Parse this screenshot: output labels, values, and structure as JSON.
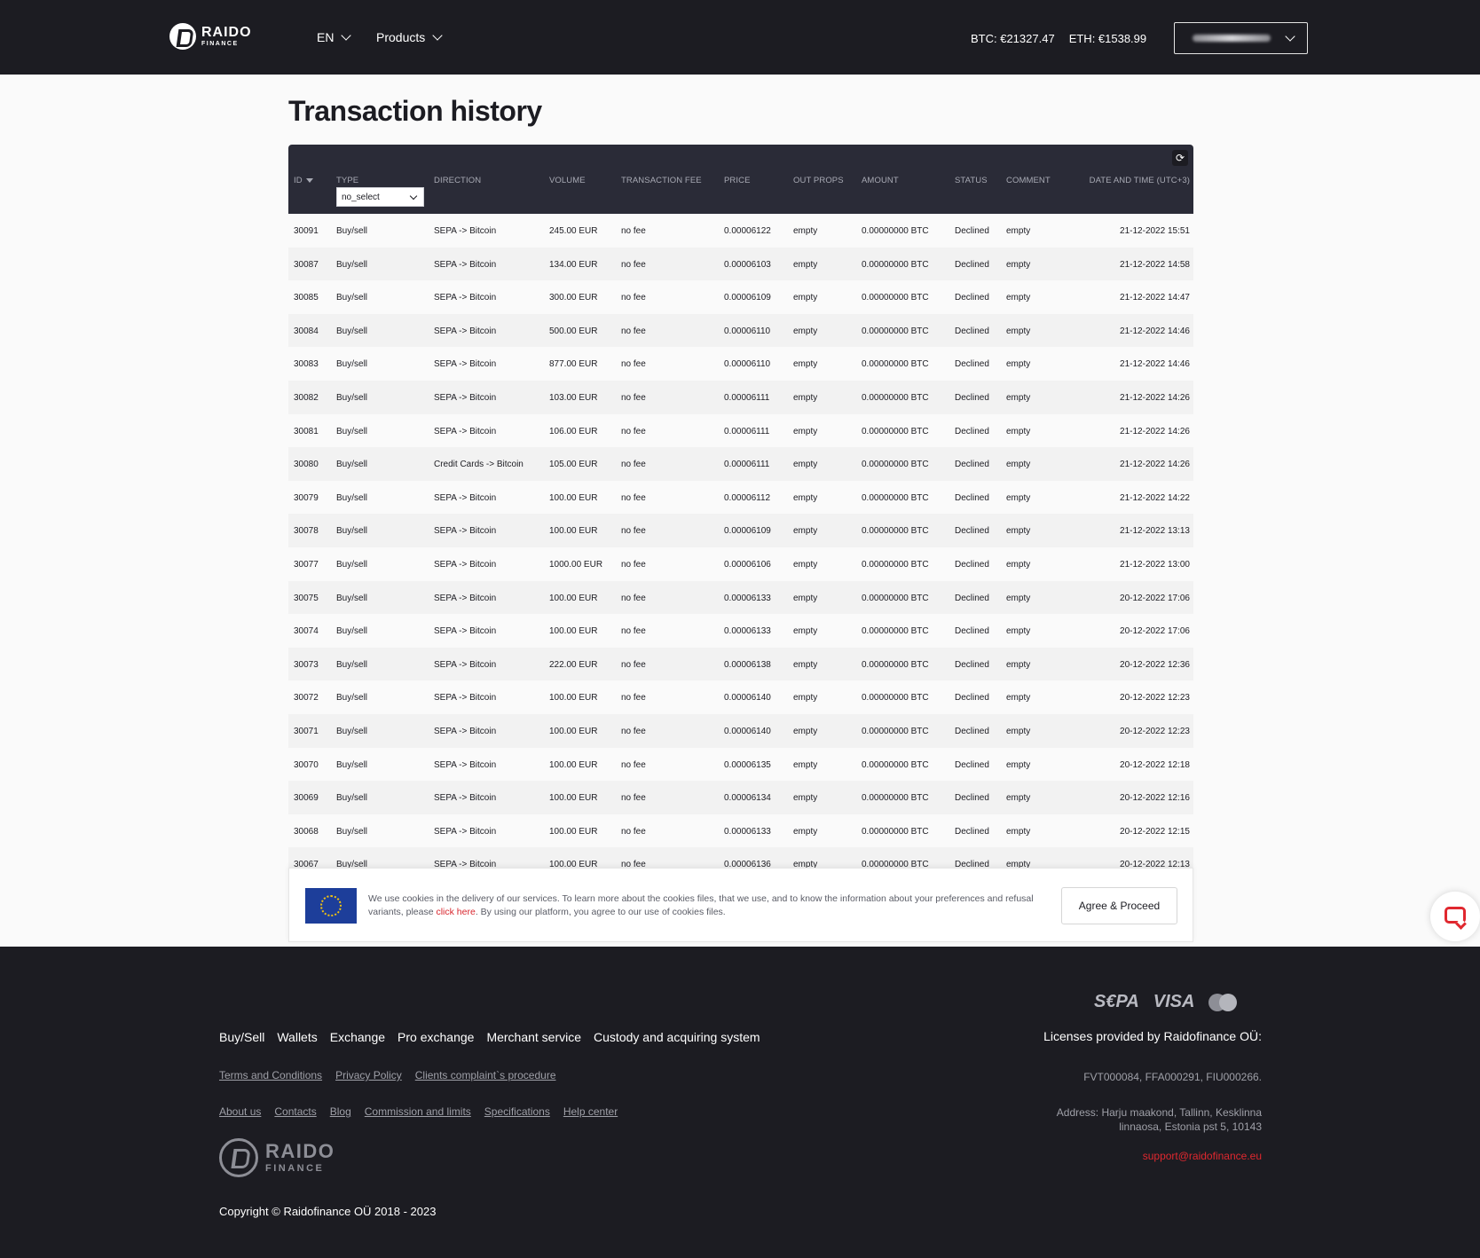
{
  "header": {
    "logo": {
      "name": "RAIDO",
      "sub": "FINANCE"
    },
    "language": "EN",
    "products": "Products",
    "btc_rate": "BTC: €21327.47",
    "eth_rate": "ETH: €1538.99"
  },
  "page": {
    "title": "Transaction history"
  },
  "table": {
    "columns": {
      "id": "ID",
      "type": "TYPE",
      "direction": "DIRECTION",
      "volume": "VOLUME",
      "fee": "TRANSACTION FEE",
      "price": "PRICE",
      "out_props": "OUT PROPS",
      "amount": "AMOUNT",
      "status": "STATUS",
      "comment": "COMMENT",
      "date": "DATE AND TIME (UTC+3)"
    },
    "type_filter": "no_select",
    "rows": [
      {
        "id": "30091",
        "type": "Buy/sell",
        "direction": "SEPA -> Bitcoin",
        "volume": "245.00 EUR",
        "fee": "no fee",
        "price": "0.00006122",
        "out_props": "empty",
        "amount": "0.00000000 BTC",
        "status": "Declined",
        "comment": "empty",
        "date": "21-12-2022 15:51"
      },
      {
        "id": "30087",
        "type": "Buy/sell",
        "direction": "SEPA -> Bitcoin",
        "volume": "134.00 EUR",
        "fee": "no fee",
        "price": "0.00006103",
        "out_props": "empty",
        "amount": "0.00000000 BTC",
        "status": "Declined",
        "comment": "empty",
        "date": "21-12-2022 14:58"
      },
      {
        "id": "30085",
        "type": "Buy/sell",
        "direction": "SEPA -> Bitcoin",
        "volume": "300.00 EUR",
        "fee": "no fee",
        "price": "0.00006109",
        "out_props": "empty",
        "amount": "0.00000000 BTC",
        "status": "Declined",
        "comment": "empty",
        "date": "21-12-2022 14:47"
      },
      {
        "id": "30084",
        "type": "Buy/sell",
        "direction": "SEPA -> Bitcoin",
        "volume": "500.00 EUR",
        "fee": "no fee",
        "price": "0.00006110",
        "out_props": "empty",
        "amount": "0.00000000 BTC",
        "status": "Declined",
        "comment": "empty",
        "date": "21-12-2022 14:46"
      },
      {
        "id": "30083",
        "type": "Buy/sell",
        "direction": "SEPA -> Bitcoin",
        "volume": "877.00 EUR",
        "fee": "no fee",
        "price": "0.00006110",
        "out_props": "empty",
        "amount": "0.00000000 BTC",
        "status": "Declined",
        "comment": "empty",
        "date": "21-12-2022 14:46"
      },
      {
        "id": "30082",
        "type": "Buy/sell",
        "direction": "SEPA -> Bitcoin",
        "volume": "103.00 EUR",
        "fee": "no fee",
        "price": "0.00006111",
        "out_props": "empty",
        "amount": "0.00000000 BTC",
        "status": "Declined",
        "comment": "empty",
        "date": "21-12-2022 14:26"
      },
      {
        "id": "30081",
        "type": "Buy/sell",
        "direction": "SEPA -> Bitcoin",
        "volume": "106.00 EUR",
        "fee": "no fee",
        "price": "0.00006111",
        "out_props": "empty",
        "amount": "0.00000000 BTC",
        "status": "Declined",
        "comment": "empty",
        "date": "21-12-2022 14:26"
      },
      {
        "id": "30080",
        "type": "Buy/sell",
        "direction": "Credit Cards -> Bitcoin",
        "volume": "105.00 EUR",
        "fee": "no fee",
        "price": "0.00006111",
        "out_props": "empty",
        "amount": "0.00000000 BTC",
        "status": "Declined",
        "comment": "empty",
        "date": "21-12-2022 14:26"
      },
      {
        "id": "30079",
        "type": "Buy/sell",
        "direction": "SEPA -> Bitcoin",
        "volume": "100.00 EUR",
        "fee": "no fee",
        "price": "0.00006112",
        "out_props": "empty",
        "amount": "0.00000000 BTC",
        "status": "Declined",
        "comment": "empty",
        "date": "21-12-2022 14:22"
      },
      {
        "id": "30078",
        "type": "Buy/sell",
        "direction": "SEPA -> Bitcoin",
        "volume": "100.00 EUR",
        "fee": "no fee",
        "price": "0.00006109",
        "out_props": "empty",
        "amount": "0.00000000 BTC",
        "status": "Declined",
        "comment": "empty",
        "date": "21-12-2022 13:13"
      },
      {
        "id": "30077",
        "type": "Buy/sell",
        "direction": "SEPA -> Bitcoin",
        "volume": "1000.00 EUR",
        "fee": "no fee",
        "price": "0.00006106",
        "out_props": "empty",
        "amount": "0.00000000 BTC",
        "status": "Declined",
        "comment": "empty",
        "date": "21-12-2022 13:00"
      },
      {
        "id": "30075",
        "type": "Buy/sell",
        "direction": "SEPA -> Bitcoin",
        "volume": "100.00 EUR",
        "fee": "no fee",
        "price": "0.00006133",
        "out_props": "empty",
        "amount": "0.00000000 BTC",
        "status": "Declined",
        "comment": "empty",
        "date": "20-12-2022 17:06"
      },
      {
        "id": "30074",
        "type": "Buy/sell",
        "direction": "SEPA -> Bitcoin",
        "volume": "100.00 EUR",
        "fee": "no fee",
        "price": "0.00006133",
        "out_props": "empty",
        "amount": "0.00000000 BTC",
        "status": "Declined",
        "comment": "empty",
        "date": "20-12-2022 17:06"
      },
      {
        "id": "30073",
        "type": "Buy/sell",
        "direction": "SEPA -> Bitcoin",
        "volume": "222.00 EUR",
        "fee": "no fee",
        "price": "0.00006138",
        "out_props": "empty",
        "amount": "0.00000000 BTC",
        "status": "Declined",
        "comment": "empty",
        "date": "20-12-2022 12:36"
      },
      {
        "id": "30072",
        "type": "Buy/sell",
        "direction": "SEPA -> Bitcoin",
        "volume": "100.00 EUR",
        "fee": "no fee",
        "price": "0.00006140",
        "out_props": "empty",
        "amount": "0.00000000 BTC",
        "status": "Declined",
        "comment": "empty",
        "date": "20-12-2022 12:23"
      },
      {
        "id": "30071",
        "type": "Buy/sell",
        "direction": "SEPA -> Bitcoin",
        "volume": "100.00 EUR",
        "fee": "no fee",
        "price": "0.00006140",
        "out_props": "empty",
        "amount": "0.00000000 BTC",
        "status": "Declined",
        "comment": "empty",
        "date": "20-12-2022 12:23"
      },
      {
        "id": "30070",
        "type": "Buy/sell",
        "direction": "SEPA -> Bitcoin",
        "volume": "100.00 EUR",
        "fee": "no fee",
        "price": "0.00006135",
        "out_props": "empty",
        "amount": "0.00000000 BTC",
        "status": "Declined",
        "comment": "empty",
        "date": "20-12-2022 12:18"
      },
      {
        "id": "30069",
        "type": "Buy/sell",
        "direction": "SEPA -> Bitcoin",
        "volume": "100.00 EUR",
        "fee": "no fee",
        "price": "0.00006134",
        "out_props": "empty",
        "amount": "0.00000000 BTC",
        "status": "Declined",
        "comment": "empty",
        "date": "20-12-2022 12:16"
      },
      {
        "id": "30068",
        "type": "Buy/sell",
        "direction": "SEPA -> Bitcoin",
        "volume": "100.00 EUR",
        "fee": "no fee",
        "price": "0.00006133",
        "out_props": "empty",
        "amount": "0.00000000 BTC",
        "status": "Declined",
        "comment": "empty",
        "date": "20-12-2022 12:15"
      },
      {
        "id": "30067",
        "type": "Buy/sell",
        "direction": "SEPA -> Bitcoin",
        "volume": "100.00 EUR",
        "fee": "no fee",
        "price": "0.00006136",
        "out_props": "empty",
        "amount": "0.00000000 BTC",
        "status": "Declined",
        "comment": "empty",
        "date": "20-12-2022 12:13"
      }
    ]
  },
  "cookie": {
    "text_before": "We use cookies in the delivery of our services. To learn more about the cookies files, that we use, and to know the information about your preferences and refusal variants, please ",
    "link": "click here",
    "text_after": ". By using our platform, you agree to our use of cookies files.",
    "button": "Agree & Proceed"
  },
  "footer": {
    "nav": [
      "Buy/Sell",
      "Wallets",
      "Exchange",
      "Pro exchange",
      "Merchant service",
      "Custody and acquiring system"
    ],
    "links1": [
      "Terms and Conditions",
      "Privacy Policy",
      "Clients complaint`s procedure"
    ],
    "links2": [
      "About us",
      "Contacts",
      "Blog",
      "Commission and limits",
      "Specifications",
      "Help center"
    ],
    "logo": {
      "name": "RAIDO",
      "sub": "FINANCE"
    },
    "copyright": "Copyright © Raidofinance OÜ 2018 - 2023",
    "payments": {
      "sepa": "S€PA",
      "visa": "VISA"
    },
    "licenses_title": "Licenses provided by Raidofinance OÜ:",
    "licenses": "FVT000084, FFA000291, FIU000266.",
    "address": "Address: Harju maakond, Tallinn, Kesklinna linnaosa, Estonia pst 5, 10143",
    "email": "support@raidofinance.eu"
  }
}
